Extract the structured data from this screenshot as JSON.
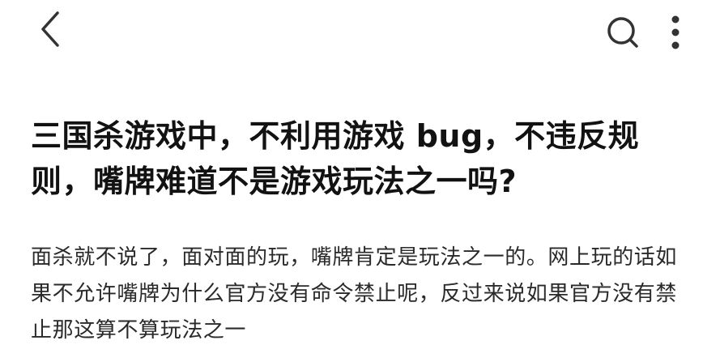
{
  "header": {
    "back_icon": "chevron-left-icon",
    "search_icon": "search-icon",
    "more_icon": "more-vertical-icon"
  },
  "question": {
    "title": "三国杀游戏中，不利用游戏 bug，不违反规则，嘴牌难道不是游戏玩法之一吗?"
  },
  "content": {
    "text": "面杀就不说了，面对面的玩，嘴牌肯定是玩法之一的。网上玩的话如果不允许嘴牌为什么官方没有命令禁止呢，反过来说如果官方没有禁止那这算不算玩法之一"
  }
}
